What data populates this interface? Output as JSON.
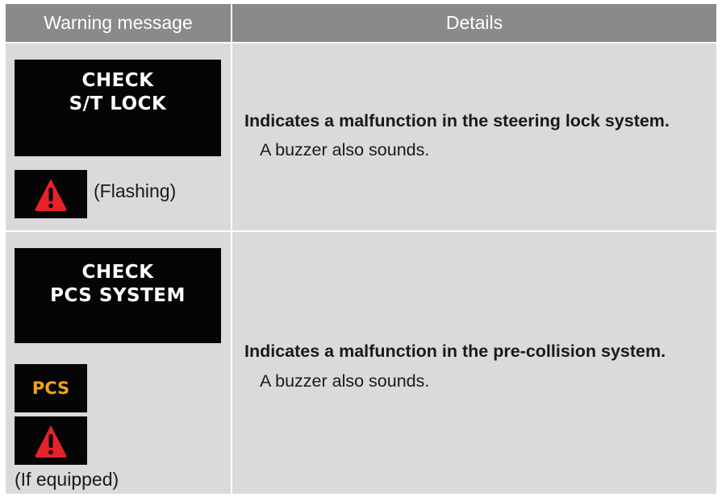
{
  "table": {
    "headers": [
      "Warning message",
      "Details"
    ],
    "rows": [
      {
        "display_lines": [
          "CHECK",
          "S/T LOCK"
        ],
        "icons": [
          "warning-triangle-icon"
        ],
        "note": "(Flashing)",
        "title": "Indicates a malfunction in the steering lock system.",
        "subtitle": "A buzzer also sounds."
      },
      {
        "display_lines": [
          "CHECK",
          "PCS SYSTEM"
        ],
        "icons": [
          "pcs-indicator-icon",
          "warning-triangle-icon"
        ],
        "pcs_label": "PCS",
        "note": "(If equipped)",
        "title": "Indicates a malfunction in the pre-collision system.",
        "subtitle": "A buzzer also sounds."
      }
    ]
  },
  "colors": {
    "header_bg": "#8a8a8a",
    "cell_bg": "#dadada",
    "display_bg": "#050505",
    "warning_red": "#e6222a",
    "pcs_orange": "#f2a31b"
  }
}
